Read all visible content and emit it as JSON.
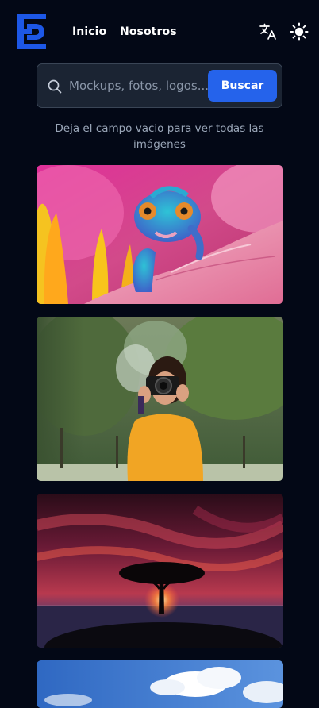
{
  "header": {
    "logo_icon": "brand-logo-icon",
    "nav": [
      {
        "label": "Inicio"
      },
      {
        "label": "Nosotros"
      }
    ],
    "translate_icon": "translate-icon",
    "theme_icon": "sun-icon"
  },
  "search": {
    "placeholder": "Mockups, fotos, logos...",
    "value": "",
    "button_label": "Buscar",
    "icon": "search-icon",
    "hint": "Deja el campo vacio para ver todas las imágenes"
  },
  "gallery": {
    "images": [
      {
        "subject": "chameleon-on-pink-flower"
      },
      {
        "subject": "woman-with-camera-in-park"
      },
      {
        "subject": "tree-silhouette-at-sunset"
      },
      {
        "subject": "blue-sky-with-clouds"
      }
    ]
  },
  "colors": {
    "background": "#030816",
    "accent": "#2563eb",
    "logo": "#1d57e6",
    "search_bg": "#1b2433",
    "hint_text": "#9aa6b8"
  }
}
